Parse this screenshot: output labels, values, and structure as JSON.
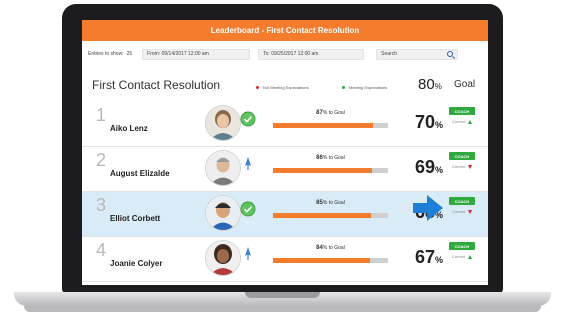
{
  "header": {
    "title": "Leaderboard - First Contact Resolution"
  },
  "filters": {
    "entries_label": "Entries to show:",
    "entries_value": "25",
    "from": "From: 09/14/2017 12:00 am",
    "to": "To: 09/25/2017 12:00 am",
    "search_placeholder": "Search"
  },
  "section": {
    "title": "First Contact Resolution",
    "legend_not_meeting": "Not Meeting Expectations",
    "legend_meeting": "Meeting Expectations",
    "goal_value": "80",
    "goal_unit": "%",
    "goal_label": "Goal"
  },
  "colors": {
    "accent": "#f47c2c",
    "highlight": "#d9ebf6",
    "coach": "#2eaa3f",
    "down": "#d9262a",
    "arrow": "#1e7fd6"
  },
  "rows": [
    {
      "rank": "1",
      "name": "Aiko Lenz",
      "progress_value": "87",
      "progress_unit": "%",
      "progress_text": "to Goal",
      "progress": 0.87,
      "score": "70",
      "score_unit": "%",
      "coach": "COACH",
      "current": "Current",
      "trend": "up",
      "badge": "green-check-icon",
      "highlighted": false
    },
    {
      "rank": "2",
      "name": "August Elizalde",
      "progress_value": "86",
      "progress_unit": "%",
      "progress_text": "to Goal",
      "progress": 0.86,
      "score": "69",
      "score_unit": "%",
      "coach": "COACH",
      "current": "Current",
      "trend": "down",
      "badge": "blue-rocket-icon",
      "highlighted": false
    },
    {
      "rank": "3",
      "name": "Elliot Corbett",
      "progress_value": "85",
      "progress_unit": "%",
      "progress_text": "to Goal",
      "progress": 0.85,
      "score": "68",
      "score_unit": "%",
      "coach": "COACH",
      "current": "Current",
      "trend": "down",
      "badge": "green-check-icon",
      "highlighted": true
    },
    {
      "rank": "4",
      "name": "Joanie Colyer",
      "progress_value": "84",
      "progress_unit": "%",
      "progress_text": "to Goal",
      "progress": 0.84,
      "score": "67",
      "score_unit": "%",
      "coach": "COACH",
      "current": "Current",
      "trend": "up",
      "badge": "blue-rocket-icon",
      "highlighted": false
    }
  ]
}
